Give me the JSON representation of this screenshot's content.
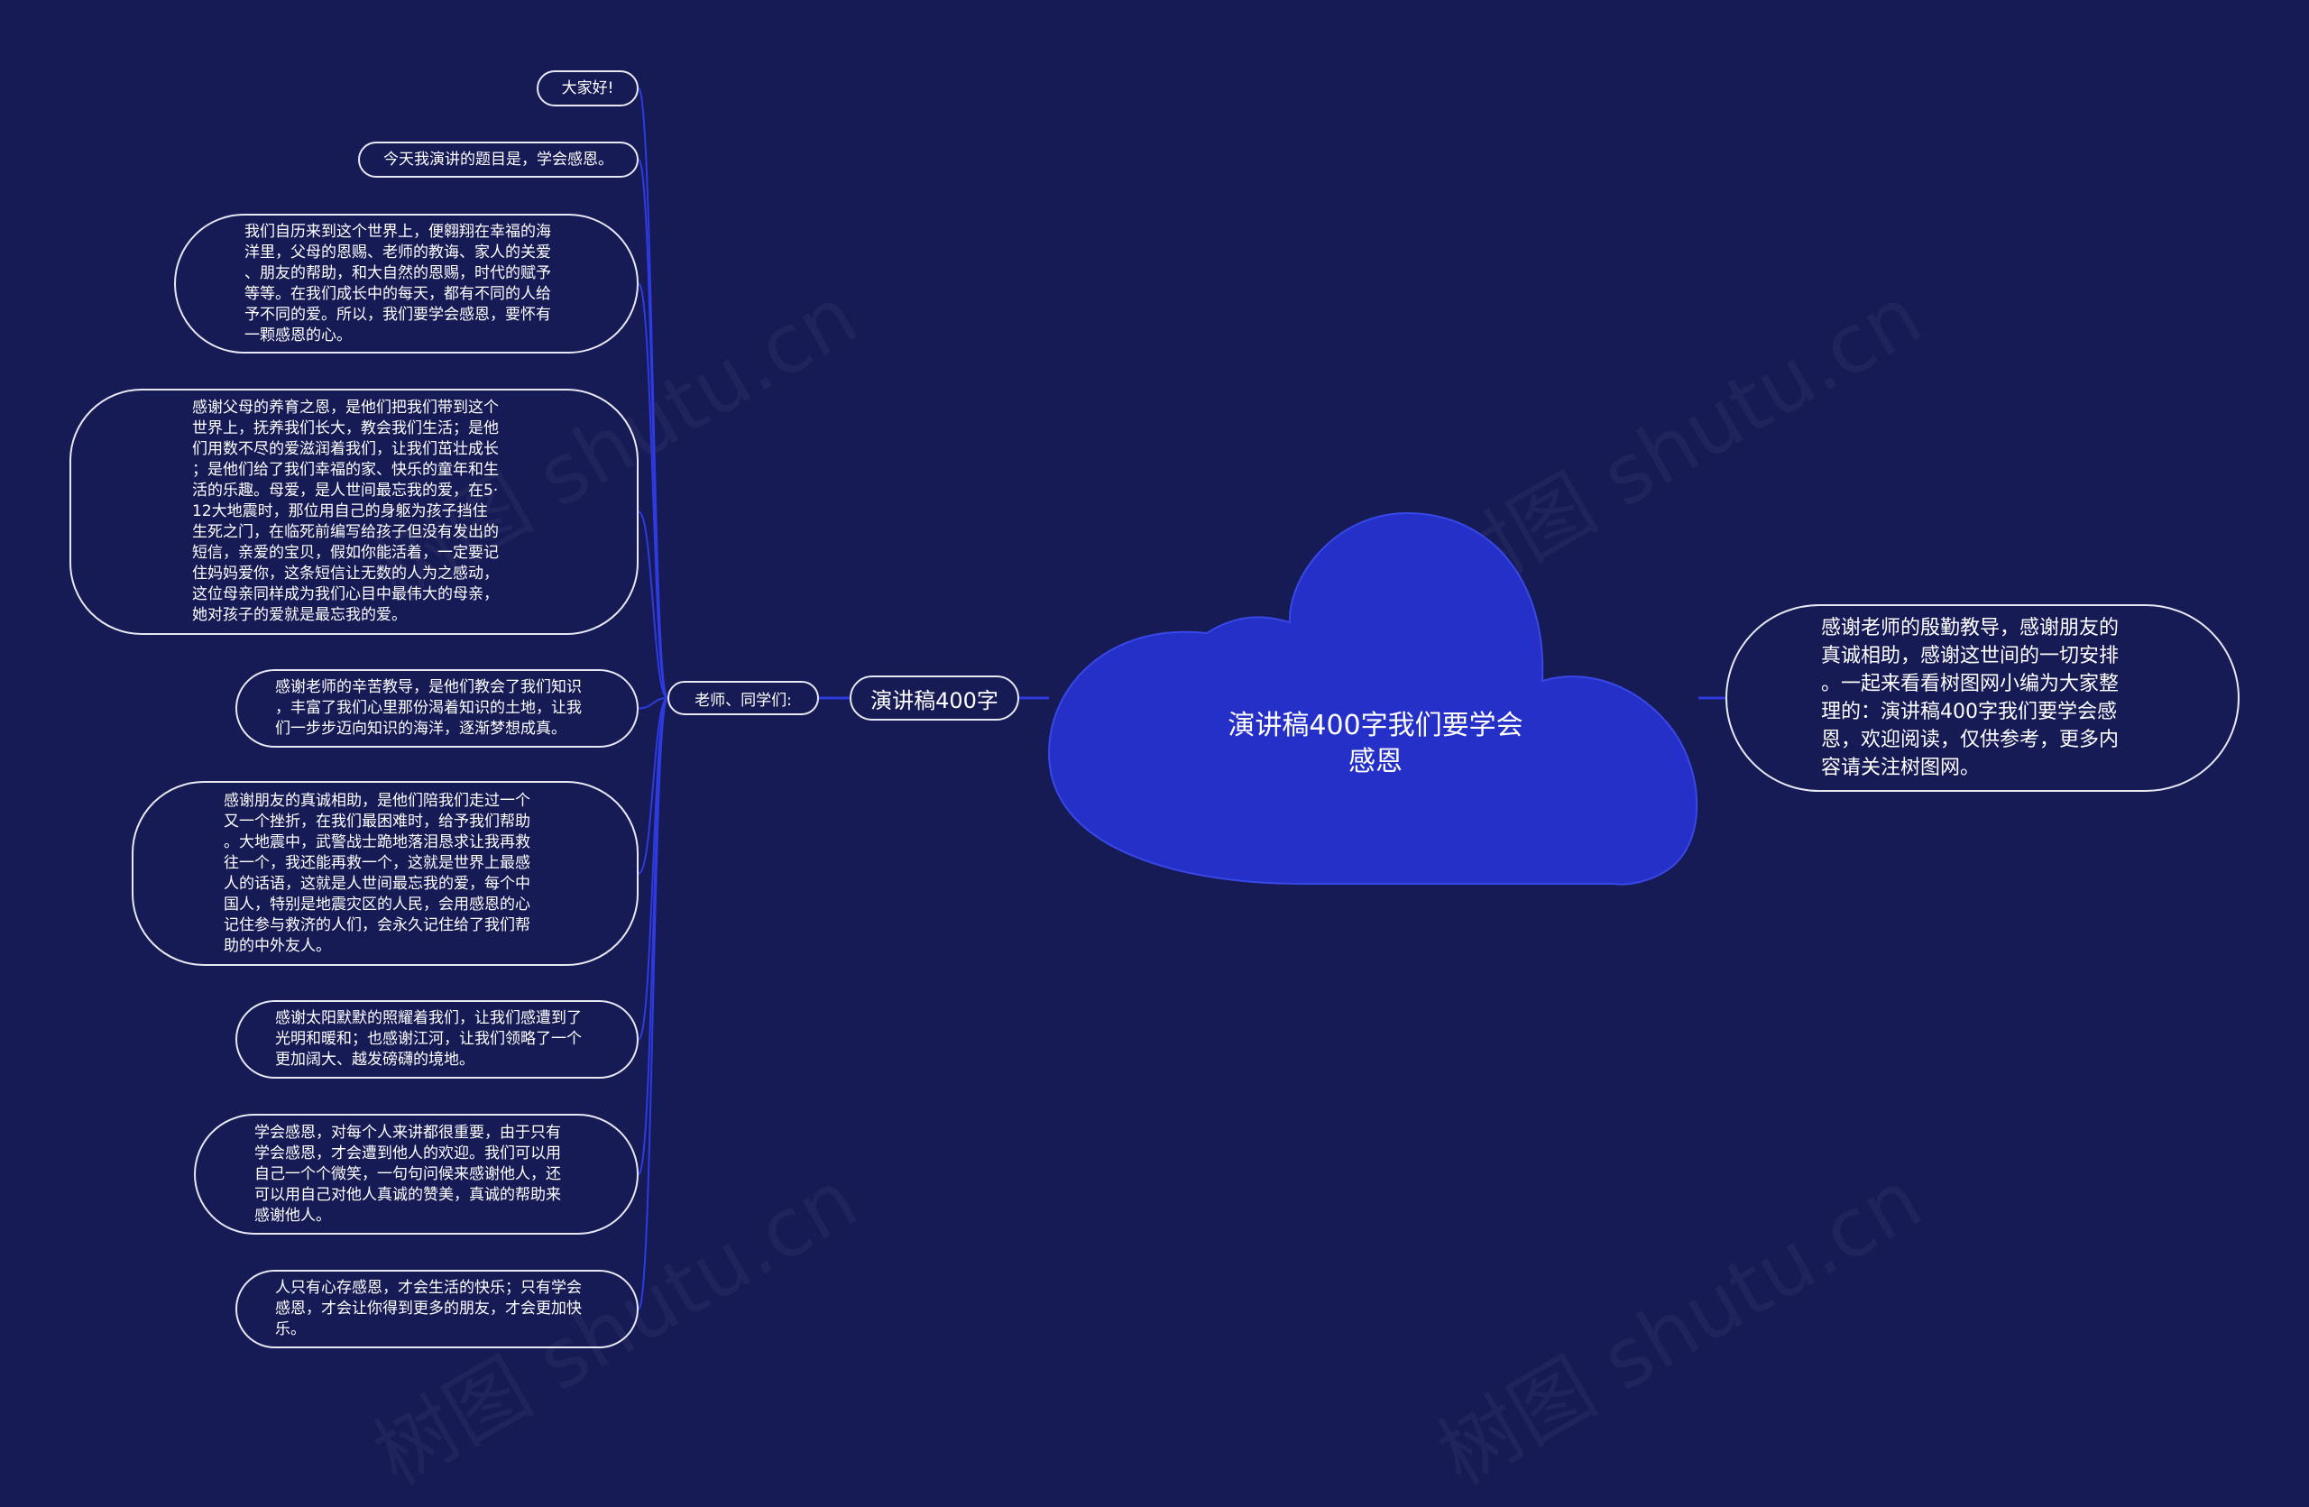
{
  "colors": {
    "background": "#161a55",
    "cloud_fill": "#2530c8",
    "cloud_stroke": "#3848e6",
    "connector": "#2d3be0",
    "node_border": "#e8e8f4",
    "text": "#ffffff"
  },
  "root": {
    "label": "演讲稿400字我们要学会\n感恩"
  },
  "branch": {
    "label": "演讲稿400字"
  },
  "sub_branch": {
    "label": "老师、同学们:"
  },
  "note": {
    "text": "感谢老师的殷勤教导，感谢朋友的\n真诚相助，感谢这世间的一切安排\n。一起来看看树图网小编为大家整\n理的：演讲稿400字我们要学会感\n恩，欢迎阅读，仅供参考，更多内\n容请关注树图网。"
  },
  "leaves": [
    {
      "text": "大家好!"
    },
    {
      "text": "今天我演讲的题目是，学会感恩。"
    },
    {
      "text": "我们自历来到这个世界上，便翱翔在幸福的海\n洋里，父母的恩赐、老师的教诲、家人的关爱\n、朋友的帮助，和大自然的恩赐，时代的赋予\n等等。在我们成长中的每天，都有不同的人给\n予不同的爱。所以，我们要学会感恩，要怀有\n一颗感恩的心。"
    },
    {
      "text": "感谢父母的养育之恩，是他们把我们带到这个\n世界上，抚养我们长大，教会我们生活；是他\n们用数不尽的爱滋润着我们，让我们茁壮成长\n；是他们给了我们幸福的家、快乐的童年和生\n活的乐趣。母爱，是人世间最忘我的爱，在5·\n12大地震时，那位用自己的身躯为孩子挡住\n生死之门，在临死前编写给孩子但没有发出的\n短信，亲爱的宝贝，假如你能活着，一定要记\n住妈妈爱你，这条短信让无数的人为之感动，\n这位母亲同样成为我们心目中最伟大的母亲，\n她对孩子的爱就是最忘我的爱。"
    },
    {
      "text": "感谢老师的辛苦教导，是他们教会了我们知识\n，丰富了我们心里那份渴着知识的土地，让我\n们一步步迈向知识的海洋，逐渐梦想成真。"
    },
    {
      "text": "感谢朋友的真诚相助，是他们陪我们走过一个\n又一个挫折，在我们最困难时，给予我们帮助\n。大地震中，武警战士跪地落泪恳求让我再救\n往一个，我还能再救一个，这就是世界上最感\n人的话语，这就是人世间最忘我的爱，每个中\n国人，特别是地震灾区的人民，会用感恩的心\n记住参与救济的人们，会永久记住给了我们帮\n助的中外友人。"
    },
    {
      "text": "感谢太阳默默的照耀着我们，让我们感遭到了\n光明和暖和；也感谢江河，让我们领略了一个\n更加阔大、越发磅礴的境地。"
    },
    {
      "text": "学会感恩，对每个人来讲都很重要，由于只有\n学会感恩，才会遭到他人的欢迎。我们可以用\n自己一个个微笑，一句句问候来感谢他人，还\n可以用自己对他人真诚的赞美，真诚的帮助来\n感谢他人。"
    },
    {
      "text": "人只有心存感恩，才会生活的快乐；只有学会\n感恩，才会让你得到更多的朋友，才会更加快\n乐。"
    }
  ]
}
